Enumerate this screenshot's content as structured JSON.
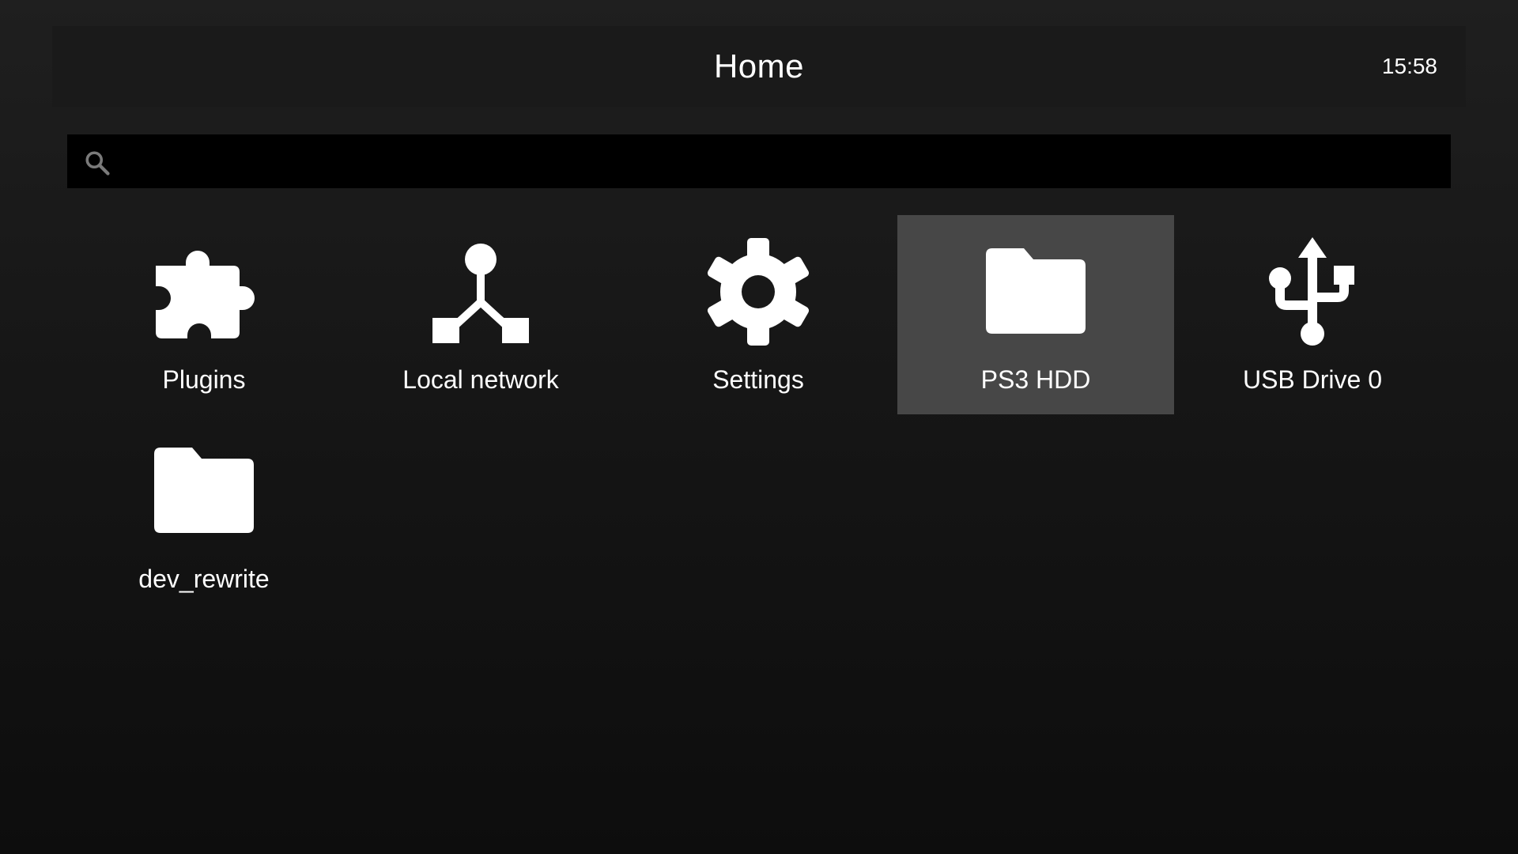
{
  "header": {
    "title": "Home",
    "clock": "15:58"
  },
  "search": {
    "placeholder": "",
    "value": ""
  },
  "items": [
    {
      "label": "Plugins",
      "icon": "puzzle-icon",
      "selected": false
    },
    {
      "label": "Local network",
      "icon": "network-icon",
      "selected": false
    },
    {
      "label": "Settings",
      "icon": "gear-icon",
      "selected": false
    },
    {
      "label": "PS3 HDD",
      "icon": "folder-icon",
      "selected": true
    },
    {
      "label": "USB Drive 0",
      "icon": "usb-icon",
      "selected": false
    },
    {
      "label": "dev_rewrite",
      "icon": "folder-icon",
      "selected": false
    }
  ],
  "colors": {
    "selected_background": "#474747",
    "search_background": "#000000"
  }
}
